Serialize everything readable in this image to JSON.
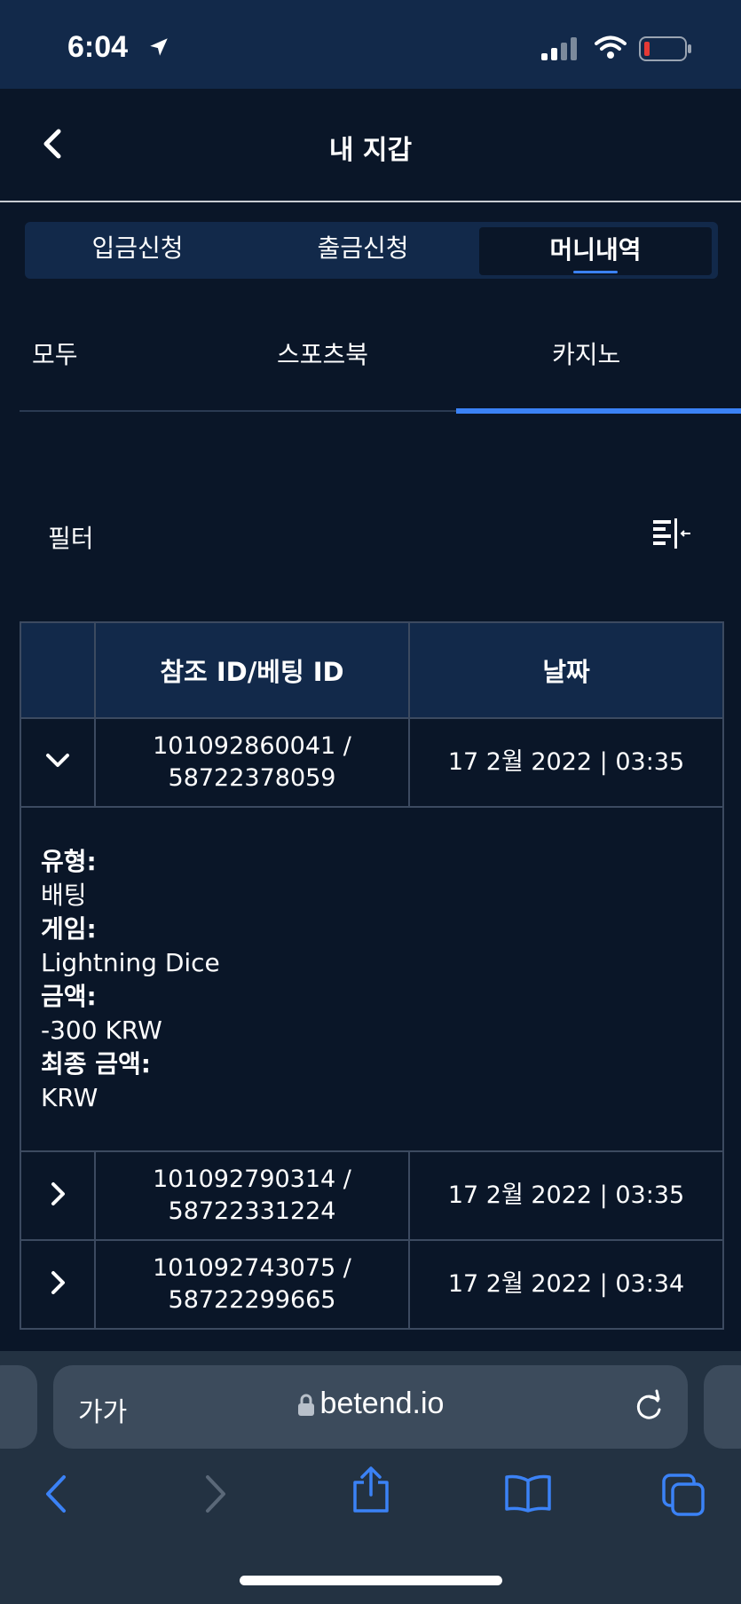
{
  "status_bar": {
    "time": "6:04"
  },
  "header": {
    "title": "내 지갑"
  },
  "wallet_tabs": [
    "입금신청",
    "출금신청",
    "머니내역"
  ],
  "category_tabs": [
    "모두",
    "스포츠북",
    "카지노"
  ],
  "filter": {
    "label": "필터"
  },
  "table": {
    "headers": {
      "ref": "참조 ID/베팅 ID",
      "date": "날짜"
    },
    "rows": [
      {
        "ref_line1": "101092860041 /",
        "ref_line2": "58722378059",
        "date": "17 2월 2022 | 03:35",
        "expanded": true
      },
      {
        "ref_line1": "101092790314 /",
        "ref_line2": "58722331224",
        "date": "17 2월 2022 | 03:35",
        "expanded": false
      },
      {
        "ref_line1": "101092743075 /",
        "ref_line2": "58722299665",
        "date": "17 2월 2022 | 03:34",
        "expanded": false
      }
    ],
    "detail": {
      "type_label": "유형:",
      "type_value": "배팅",
      "game_label": "게임:",
      "game_value": "Lightning Dice",
      "amount_label": "금액:",
      "amount_value": "-300 KRW",
      "final_label": "최종 금액:",
      "final_value": "KRW"
    }
  },
  "browser": {
    "text_size": "가가",
    "url": "betend.io"
  },
  "colors": {
    "accent": "#3b82f6",
    "background": "#0a1628",
    "panel": "#12294a",
    "battery_low": "#e53935"
  },
  "icons": [
    "location-arrow-icon",
    "signal-icon",
    "wifi-icon",
    "battery-icon",
    "back-chevron-icon",
    "filter-icon",
    "chevron-down-icon",
    "chevron-right-icon",
    "lock-icon",
    "reload-icon",
    "safari-back-icon",
    "safari-forward-icon",
    "share-icon",
    "bookmarks-icon",
    "tabs-icon"
  ]
}
